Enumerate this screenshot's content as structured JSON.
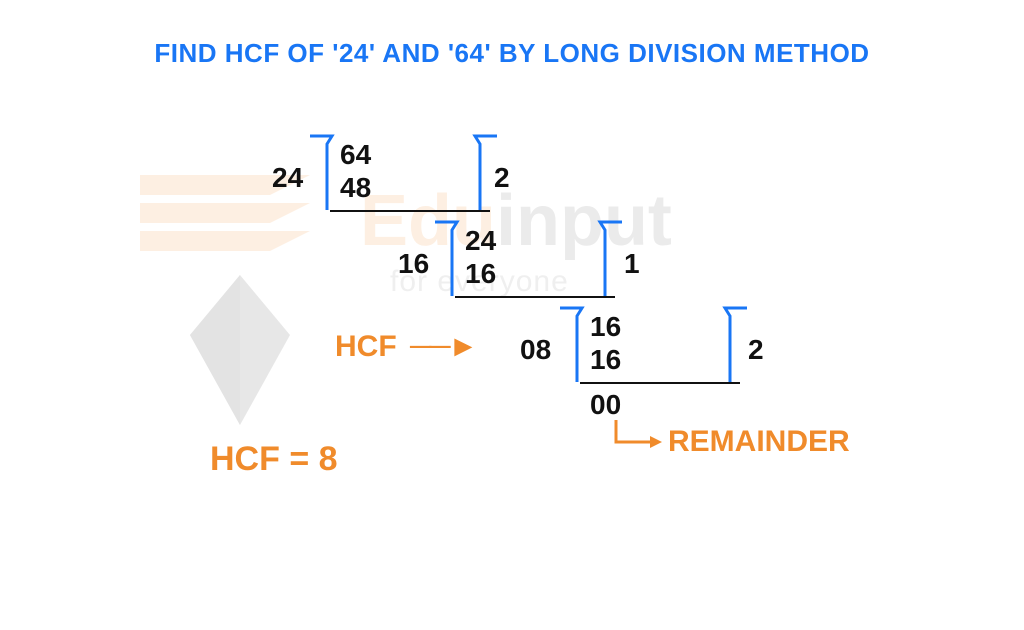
{
  "title": "FIND HCF OF '24' AND '64' BY LONG DIVISION METHOD",
  "watermark": {
    "brand_a": "Edu",
    "brand_b": "input",
    "tagline": "for everyone"
  },
  "step1": {
    "divisor": "24",
    "dividend": "64",
    "product": "48",
    "quotient": "2"
  },
  "step2": {
    "divisor": "16",
    "dividend": "24",
    "product": "16",
    "quotient": "1"
  },
  "step3": {
    "divisor": "08",
    "dividend": "16",
    "product": "16",
    "quotient": "2"
  },
  "final_remainder": "00",
  "hcf_label": "HCF",
  "hcf_result": "HCF = 8",
  "remainder_label": "REMAINDER"
}
